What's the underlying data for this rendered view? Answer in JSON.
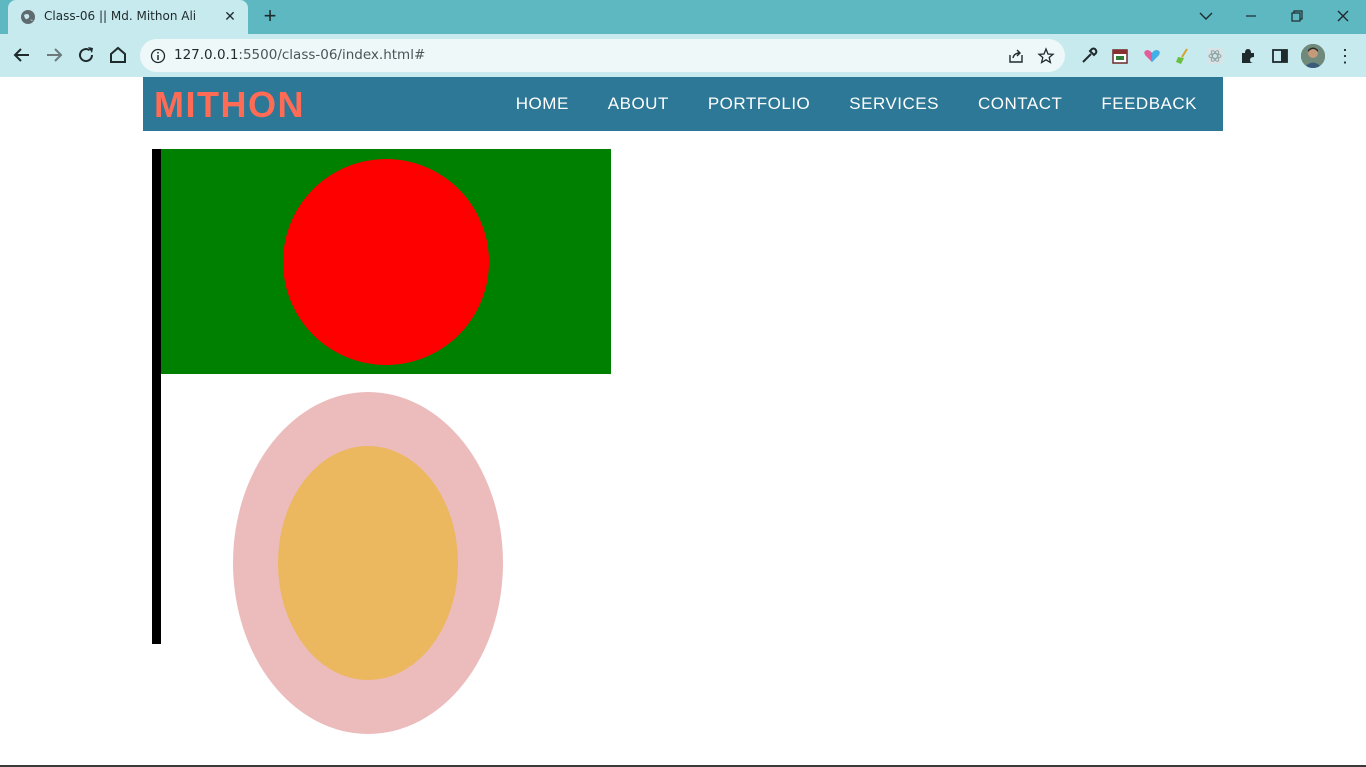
{
  "browser": {
    "tab_title": "Class-06 || Md. Mithon Ali",
    "url_host": "127.0.0.1",
    "url_rest": ":5500/class-06/index.html#",
    "icons": {
      "favicon": "globe-icon",
      "close": "close-icon",
      "new_tab": "plus-icon",
      "back": "back-arrow-icon",
      "forward": "forward-arrow-icon",
      "reload": "reload-icon",
      "home": "home-icon",
      "info": "info-icon",
      "share": "share-icon",
      "bookmark": "star-icon",
      "menu": "more-vertical-icon"
    }
  },
  "site": {
    "logo": "MITHON",
    "nav": [
      "HOME",
      "ABOUT",
      "PORTFOLIO",
      "SERVICES",
      "CONTACT",
      "FEEDBACK"
    ]
  },
  "colors": {
    "header_bg": "#2c7896",
    "logo": "#ff6b55",
    "flag_green": "#008000",
    "flag_red": "#ff0000",
    "flag_pole": "#000000",
    "oval_outer": "#ecbcbc",
    "oval_inner": "#ebb75f"
  }
}
